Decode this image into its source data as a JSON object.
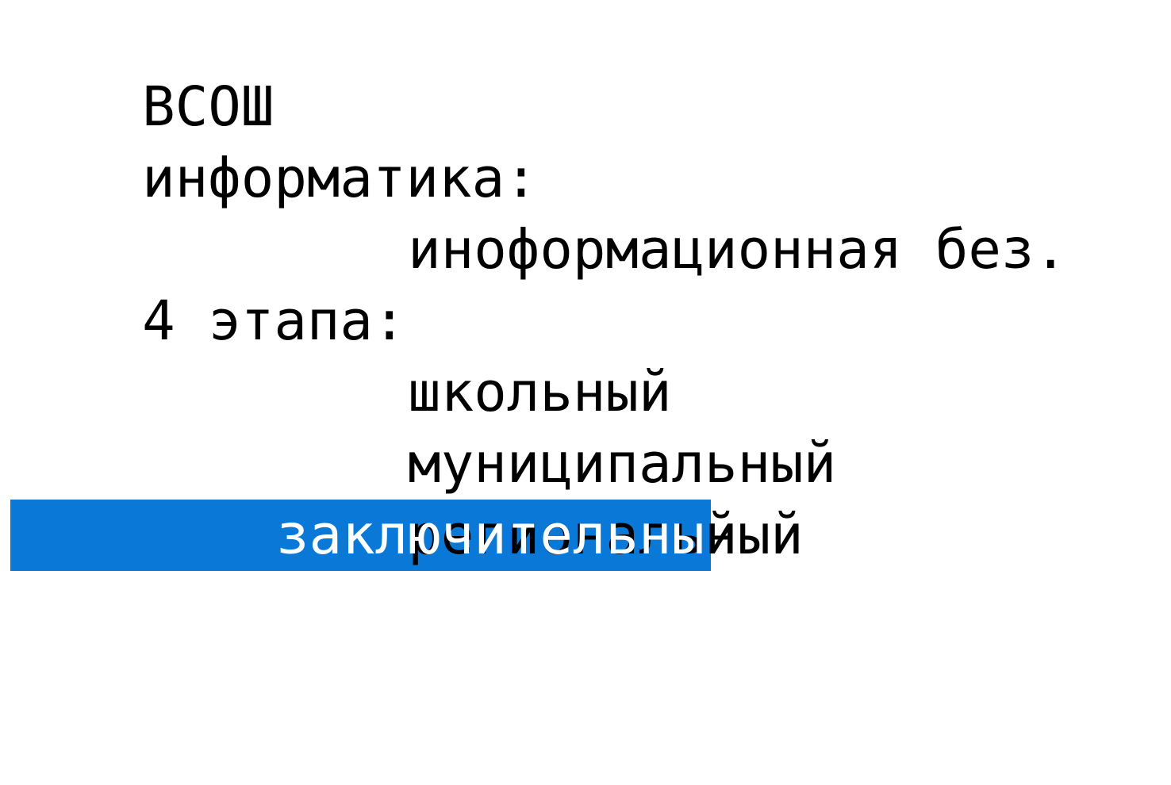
{
  "editor": {
    "lines": [
      {
        "text": "ВСОШ"
      },
      {
        "text": "информатика:"
      },
      {
        "text": "инoформационная без."
      },
      {
        "text": "4 этапа:"
      },
      {
        "text": "школьный"
      },
      {
        "text": "муниципальный"
      },
      {
        "text": "региональный"
      }
    ],
    "selected_line": {
      "selected_text": "заключительны",
      "unselected_text": "й"
    },
    "selection_color": "#0a78d6"
  }
}
